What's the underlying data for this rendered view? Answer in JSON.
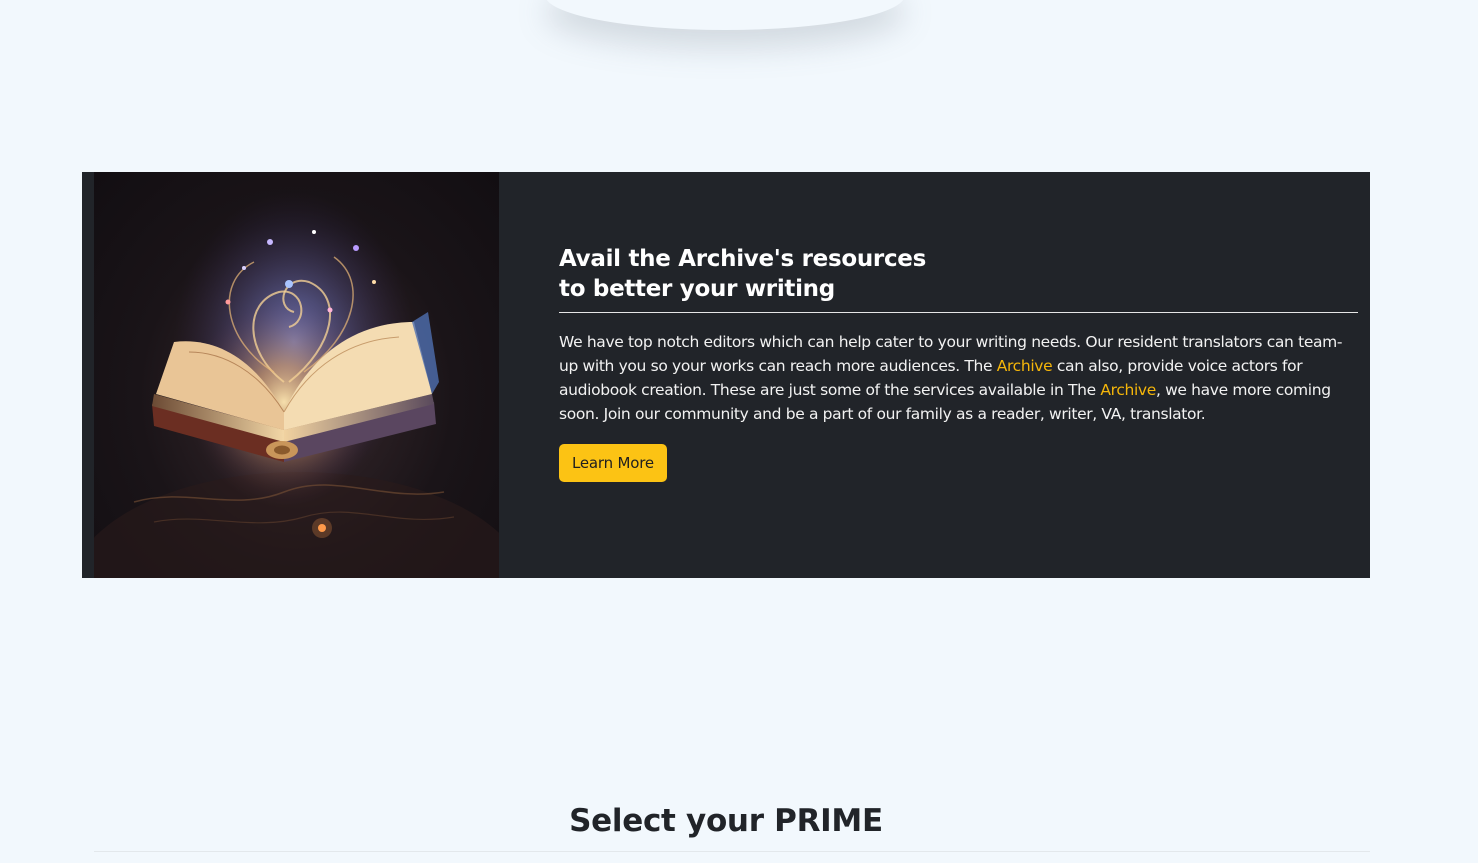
{
  "banner": {
    "image_icon": "open-magic-book-illustration",
    "title_line1": "Avail the Archive's resources",
    "title_line2": "to better your writing",
    "body_part1": "We have top notch editors which can help cater to your writing needs. Our resident translators can team-up with you so your works can reach more audiences. The ",
    "body_link1": "Archive",
    "body_part2": " can also, provide voice actors for audiobook creation. These are just some of the services available in The ",
    "body_link2": "Archive",
    "body_part3": ", we have more coming soon. Join our community and be a part of our family as a reader, writer, VA, translator.",
    "button_label": "Learn More"
  },
  "section": {
    "title": "Select your PRIME"
  },
  "colors": {
    "page_background": "#f2f8fd",
    "banner_background": "#212429",
    "accent": "#f5b60a",
    "button": "#fcc314"
  }
}
